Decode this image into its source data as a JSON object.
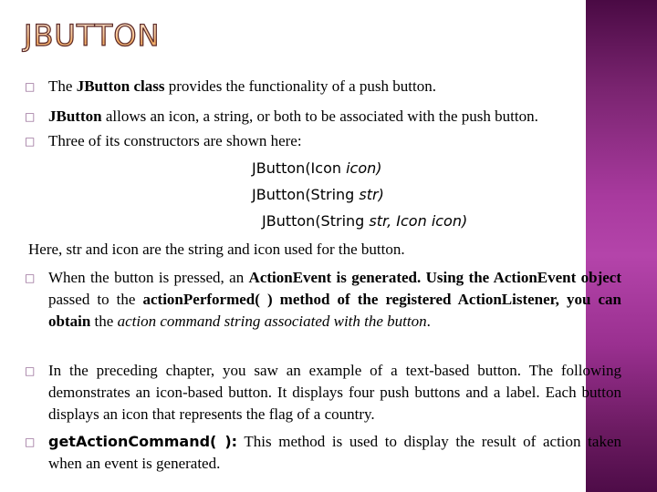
{
  "title": "JBUTTON",
  "colors": {
    "band_top": "#4a0a44",
    "band_mid": "#b444aa",
    "band_bottom": "#4e0c48",
    "bullet": "#8a5a8a"
  },
  "bullet_icon": "hollow-square-bullet",
  "bullets_top": [
    {
      "pre": "The ",
      "bold": "JButton class",
      "post": " provides the functionality of a push button."
    },
    {
      "pre": "",
      "bold": "JButton",
      "post": " allows an icon, a string, or both to be associated with the push button."
    },
    {
      "pre": "Three of its constructors are shown here:",
      "bold": "",
      "post": ""
    }
  ],
  "constructors": [
    {
      "plain": "JButton(Icon ",
      "italic": "icon)"
    },
    {
      "plain": "JButton(String ",
      "italic": "str)"
    },
    {
      "plain": "JButton(String ",
      "italic": "str, Icon icon)"
    }
  ],
  "note": "Here, str and icon are the string and icon used for the button.",
  "bullet_action": {
    "p1": "When the button is pressed, an ",
    "b1": "ActionEvent is generated. Using the ActionEvent object",
    "p2": " passed to the ",
    "b2": "actionPerformed( ) method of the registered ActionListener, you can obtain",
    "p3": " the ",
    "i1": "action command string associated with the button",
    "p4": "."
  },
  "bullet_preceding": "In the preceding chapter, you saw an example of a text-based button. The following demonstrates an icon-based button. It displays four push buttons and a label. Each button displays an icon that represents the flag of a country.",
  "bullet_getaction": {
    "bold": "getActionCommand( ):",
    "text": " This method is used to display the result of action taken when an event is generated."
  }
}
